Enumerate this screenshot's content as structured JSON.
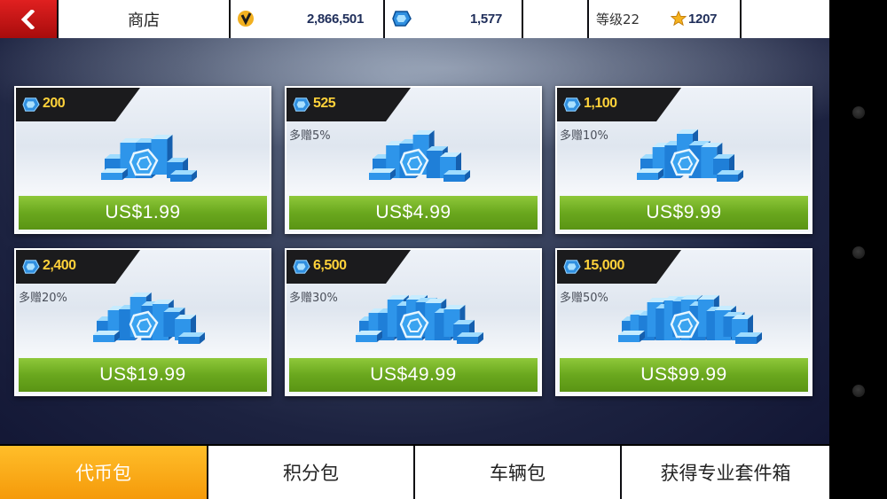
{
  "header": {
    "title": "商店",
    "credits": "2,866,501",
    "gems": "1,577",
    "level_label": "等级22",
    "stars": "1207"
  },
  "packs": [
    {
      "amount": "200",
      "bonus": "",
      "price": "US$1.99",
      "boxes": 5
    },
    {
      "amount": "525",
      "bonus": "多赠5%",
      "price": "US$4.99",
      "boxes": 6
    },
    {
      "amount": "1,100",
      "bonus": "多赠10%",
      "price": "US$9.99",
      "boxes": 7
    },
    {
      "amount": "2,400",
      "bonus": "多赠20%",
      "price": "US$19.99",
      "boxes": 8
    },
    {
      "amount": "6,500",
      "bonus": "多赠30%",
      "price": "US$49.99",
      "boxes": 11
    },
    {
      "amount": "15,000",
      "bonus": "多赠50%",
      "price": "US$99.99",
      "boxes": 14
    }
  ],
  "tabs": [
    {
      "label": "代币包",
      "active": true
    },
    {
      "label": "积分包",
      "active": false
    },
    {
      "label": "车辆包",
      "active": false
    },
    {
      "label": "获得专业套件箱",
      "active": false
    }
  ],
  "colors": {
    "accent_orange": "#f59a0a",
    "price_green": "#6aa81e",
    "gem_blue": "#2f8fe0",
    "amount_yellow": "#ffd23a",
    "back_red": "#d01818"
  },
  "icons": {
    "back": "chevron-left-icon",
    "credits": "credits-icon",
    "gem": "gem-icon",
    "star": "star-icon"
  }
}
